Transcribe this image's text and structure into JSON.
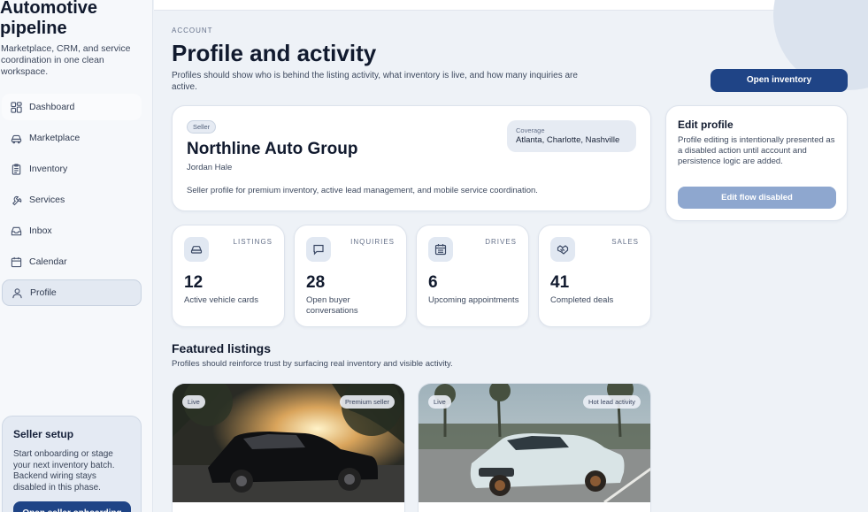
{
  "brand": {
    "title": "Automotive pipeline",
    "subtitle": "Marketplace, CRM, and service coordination in one clean workspace."
  },
  "nav": [
    {
      "label": "Dashboard",
      "icon": "dashboard-icon",
      "active": false
    },
    {
      "label": "Marketplace",
      "icon": "car-icon",
      "active": false
    },
    {
      "label": "Inventory",
      "icon": "clipboard-icon",
      "active": false
    },
    {
      "label": "Services",
      "icon": "wrench-icon",
      "active": false
    },
    {
      "label": "Inbox",
      "icon": "inbox-icon",
      "active": false
    },
    {
      "label": "Calendar",
      "icon": "calendar-icon",
      "active": false
    },
    {
      "label": "Profile",
      "icon": "user-icon",
      "active": true
    }
  ],
  "setup": {
    "title": "Seller setup",
    "text": "Start onboarding or stage your next inventory batch. Backend wiring stays disabled in this phase.",
    "button_label": "Open seller onboarding"
  },
  "header": {
    "eyebrow": "ACCOUNT",
    "title": "Profile and activity",
    "description": "Profiles should show who is behind the listing activity, what inventory is live, and how many inquiries are active.",
    "primary_button": "Open inventory"
  },
  "profile": {
    "badge": "Seller",
    "coverage_label": "Coverage",
    "coverage_value": "Atlanta, Charlotte, Nashville",
    "company": "Northline Auto Group",
    "owner": "Jordan Hale",
    "description": "Seller profile for premium inventory, active lead management, and mobile service coordination."
  },
  "edit": {
    "title": "Edit profile",
    "text": "Profile editing is intentionally presented as a disabled action until account and persistence logic are added.",
    "button_label": "Edit flow disabled"
  },
  "stats": [
    {
      "label": "LISTINGS",
      "value": "12",
      "desc": "Active vehicle cards",
      "icon": "car-icon"
    },
    {
      "label": "INQUIRIES",
      "value": "28",
      "desc": "Open buyer conversations",
      "icon": "chat-icon"
    },
    {
      "label": "DRIVES",
      "value": "6",
      "desc": "Upcoming appointments",
      "icon": "calendar-icon"
    },
    {
      "label": "SALES",
      "value": "41",
      "desc": "Completed deals",
      "icon": "handshake-icon"
    }
  ],
  "featured": {
    "title": "Featured listings",
    "subtitle": "Profiles should reinforce trust by surfacing real inventory and visible activity.",
    "listings": [
      {
        "status": "Live",
        "tag": "Premium seller"
      },
      {
        "status": "Live",
        "tag": "Hot lead activity"
      }
    ]
  },
  "colors": {
    "accent": "#1f4486",
    "disabled": "#8ea7cf",
    "background": "#eef2f7",
    "card": "#ffffff"
  }
}
